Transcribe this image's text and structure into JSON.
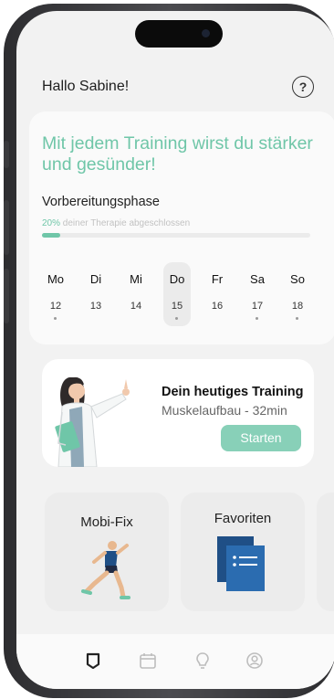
{
  "greeting": "Hallo Sabine!",
  "help_symbol": "?",
  "motto": "Mit jedem Training wirst du stärker und gesünder!",
  "phase": {
    "title": "Vorbereitungsphase",
    "progress_percent_label": "20%",
    "progress_text": "deiner Therapie abgeschlossen",
    "progress_fraction": 0.2
  },
  "week": [
    {
      "name": "Mo",
      "num": "12",
      "selected": false
    },
    {
      "name": "Di",
      "num": "13",
      "selected": false
    },
    {
      "name": "Mi",
      "num": "14",
      "selected": false
    },
    {
      "name": "Do",
      "num": "15",
      "selected": true
    },
    {
      "name": "Fr",
      "num": "16",
      "selected": false
    },
    {
      "name": "Sa",
      "num": "17",
      "selected": false
    },
    {
      "name": "So",
      "num": "18",
      "selected": false
    }
  ],
  "training": {
    "title": "Dein heutiges Training",
    "subtitle": "Muskelaufbau - 32min",
    "button": "Starten"
  },
  "tiles": {
    "mobifix": "Mobi-Fix",
    "favoriten": "Favoriten"
  },
  "nav": [
    "home-icon",
    "calendar-icon",
    "lightbulb-icon",
    "profile-icon"
  ],
  "colors": {
    "accent": "#6fc6a8",
    "button": "#88d0b8",
    "navy": "#1f4f86"
  }
}
